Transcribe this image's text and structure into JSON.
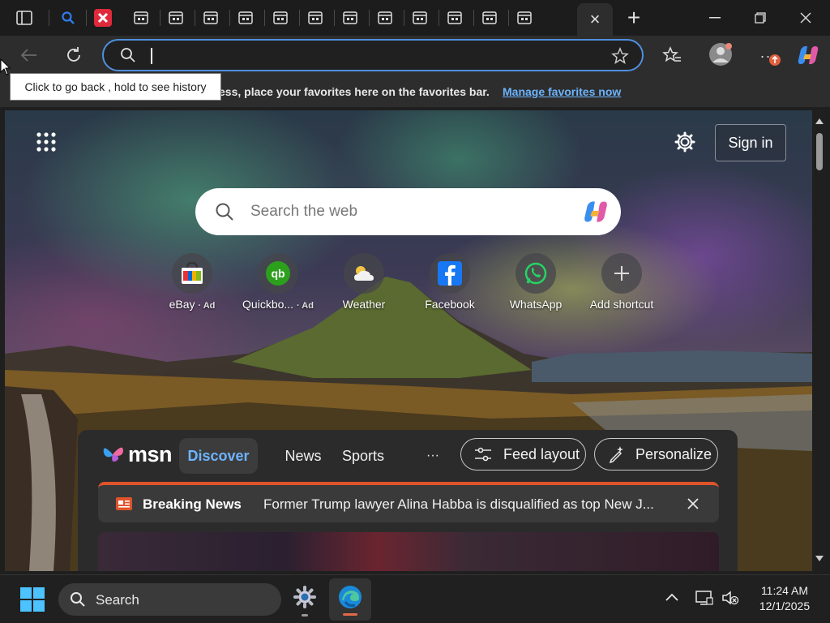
{
  "browser": {
    "tabs": {
      "count_background_tabs": 12,
      "close_tab_label": "×",
      "new_tab_label": "+"
    },
    "address_bar": {
      "value": "",
      "placeholder": ""
    },
    "tooltip": "Click to go back , hold to see history",
    "favorites_bar": {
      "message": "ess, place your favorites here on the favorites bar.",
      "link": "Manage favorites now"
    },
    "accent_color": "#4f8fde"
  },
  "newtab": {
    "sign_in": "Sign in",
    "search_placeholder": "Search the web",
    "shortcuts": [
      {
        "label": "eBay",
        "ad": "· Ad",
        "icon": "ebay-bag-icon"
      },
      {
        "label": "Quickbo...",
        "ad": "· Ad",
        "icon": "quickbooks-icon"
      },
      {
        "label": "Weather",
        "ad": "",
        "icon": "weather-cloud-icon"
      },
      {
        "label": "Facebook",
        "ad": "",
        "icon": "facebook-icon"
      },
      {
        "label": "WhatsApp",
        "ad": "",
        "icon": "whatsapp-icon"
      },
      {
        "label": "Add shortcut",
        "ad": "",
        "icon": "plus-icon"
      }
    ]
  },
  "msn": {
    "logo": "msn",
    "tabs": [
      "Discover",
      "News",
      "Sports"
    ],
    "more": "···",
    "feed_layout": "Feed layout",
    "personalize": "Personalize",
    "breaking_label": "Breaking News",
    "breaking_text": "Former Trump lawyer Alina Habba is disqualified as top New J..."
  },
  "taskbar": {
    "search_label": "Search",
    "time": "11:24 AM",
    "date": "12/1/2025"
  }
}
